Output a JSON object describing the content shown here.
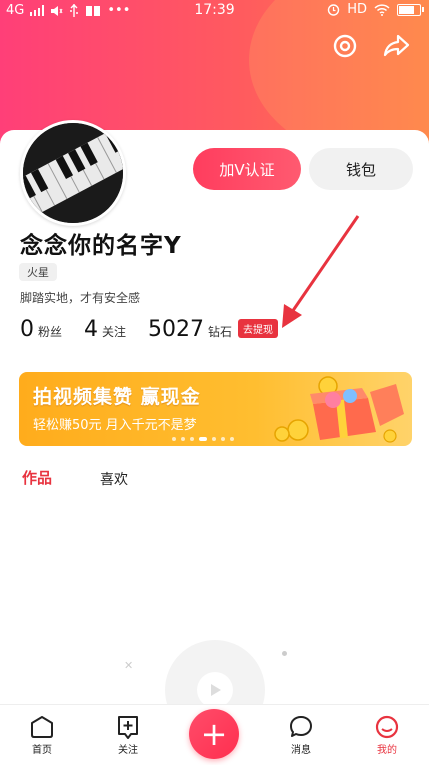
{
  "status_bar": {
    "network": "4G",
    "time": "17:39",
    "hd": "HD",
    "dots": "•••"
  },
  "profile": {
    "verify_button": "加V认证",
    "wallet_button": "钱包",
    "username": "念念你的名字Y",
    "tag": "火星",
    "bio": "脚踏实地，才有安全感",
    "stats": [
      {
        "value": "0",
        "label": "粉丝"
      },
      {
        "value": "4",
        "label": "关注"
      },
      {
        "value": "5027",
        "label": "钻石"
      }
    ],
    "withdraw_label": "去提现"
  },
  "banner": {
    "title": "拍视频集赞 赢现金",
    "subtitle": "轻松赚50元 月入千元不是梦",
    "page_count": 7,
    "active_page": 3
  },
  "tabs": {
    "works": "作品",
    "likes": "喜欢"
  },
  "tabbar": {
    "home": "首页",
    "follow": "关注",
    "messages": "消息",
    "me": "我的",
    "plus": "+"
  },
  "colors": {
    "accent": "#e8333f",
    "header_gradient_start": "#ff3f78",
    "header_gradient_end": "#ff7a49",
    "banner": "#ffb62a"
  }
}
